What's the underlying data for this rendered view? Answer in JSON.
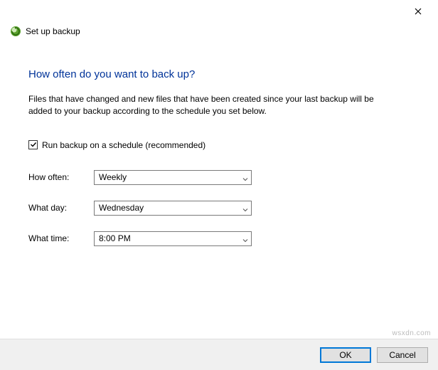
{
  "window": {
    "title": "Set up backup",
    "close_icon": "close"
  },
  "content": {
    "heading": "How often do you want to back up?",
    "description": "Files that have changed and new files that have been created since your last backup will be added to your backup according to the schedule you set below.",
    "schedule_checkbox": {
      "label": "Run backup on a schedule (recommended)",
      "checked": true
    },
    "fields": {
      "how_often": {
        "label": "How often:",
        "value": "Weekly"
      },
      "what_day": {
        "label": "What day:",
        "value": "Wednesday"
      },
      "what_time": {
        "label": "What time:",
        "value": "8:00 PM"
      }
    }
  },
  "footer": {
    "ok": "OK",
    "cancel": "Cancel"
  },
  "watermark": "wsxdn.com"
}
